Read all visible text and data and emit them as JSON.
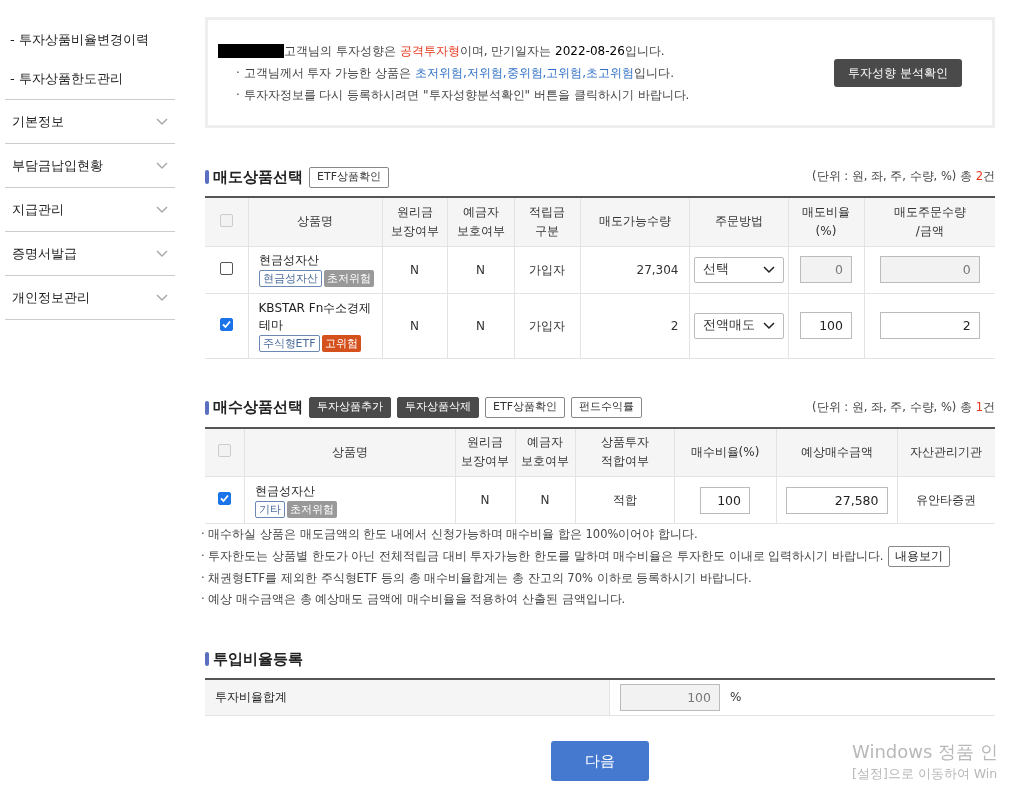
{
  "sidebar": {
    "sub_items": [
      "- 투자상품비율변경이력",
      "- 투자상품한도관리"
    ],
    "menu": [
      {
        "label": "기본정보",
        "expanded": false
      },
      {
        "label": "부담금납입현황",
        "expanded": false
      },
      {
        "label": "지급관리",
        "expanded": false
      },
      {
        "label": "증명서발급",
        "expanded": false
      },
      {
        "label": "개인정보관리",
        "expanded": false
      }
    ]
  },
  "profile": {
    "redacted": true,
    "lines": [
      [
        {
          "text": "고객님의 투자성향은 ",
          "kind": "plain"
        },
        {
          "text": "공격투자형",
          "kind": "warning"
        },
        {
          "text": "이며, 만기일자는 ",
          "kind": "plain"
        },
        {
          "text": "2022-08-26",
          "kind": "date"
        },
        {
          "text": "입니다.",
          "kind": "plain"
        }
      ],
      [
        {
          "text": "· 고객님께서 투자 가능한 상품은 ",
          "kind": "plain"
        },
        {
          "text": "초저위험,저위험,중위험,고위험,초고위험",
          "kind": "info"
        },
        {
          "text": "입니다.",
          "kind": "plain"
        }
      ],
      [
        {
          "text": "· 투자자정보를 다시 등록하시려면 \"투자성향분석확인\" 버튼을 클릭하시기 바랍니다.",
          "kind": "plain"
        }
      ]
    ],
    "button": "투자성향 분석확인"
  },
  "sell": {
    "title": "매도상품선택",
    "buttons": [
      {
        "label": "ETF상품확인",
        "kind": "outline"
      }
    ],
    "unit_note": "(단위 : 원, 좌, 주, 수량, %) 총",
    "count": "2",
    "count_suffix": "건",
    "columns": [
      "상품명",
      "원리금\n보장여부",
      "예금자\n보호여부",
      "적립금\n구분",
      "매도가능수량",
      "주문방법",
      "매도비율\n(%)",
      "매도주문수량\n/금액"
    ],
    "header_checkbox": {
      "checked": false,
      "disabled": true
    },
    "rows": [
      {
        "checked": false,
        "name": "현금성자산",
        "tags": [
          {
            "label": "현금성자산",
            "kind": "outline"
          },
          {
            "label": "초저위험",
            "kind": "filled",
            "color": "#999999"
          }
        ],
        "principal": "N",
        "depositor": "N",
        "type": "가입자",
        "available": "27,304",
        "method": "선택",
        "ratio": "0",
        "amount": "0",
        "disabled": true
      },
      {
        "checked": true,
        "name": "KBSTAR Fn수소경제테마",
        "tags": [
          {
            "label": "주식형ETF",
            "kind": "outline"
          },
          {
            "label": "고위험",
            "kind": "filled",
            "color": "#d4501c"
          }
        ],
        "principal": "N",
        "depositor": "N",
        "type": "가입자",
        "available": "2",
        "method": "전액매도",
        "ratio": "100",
        "amount": "2",
        "disabled": false
      }
    ]
  },
  "buy": {
    "title": "매수상품선택",
    "buttons": [
      {
        "label": "투자상품추가",
        "kind": "dark"
      },
      {
        "label": "투자상품삭제",
        "kind": "dark"
      },
      {
        "label": "ETF상품확인",
        "kind": "outline"
      },
      {
        "label": "펀드수익률",
        "kind": "outline"
      }
    ],
    "unit_note": "(단위 : 원, 좌, 주, 수량, %) 총",
    "count": "1",
    "count_suffix": "건",
    "columns": [
      "상품명",
      "원리금\n보장여부",
      "예금자\n보호여부",
      "상품투자\n적합여부",
      "매수비율(%)",
      "예상매수금액",
      "자산관리기관"
    ],
    "header_checkbox": {
      "checked": false,
      "disabled": true
    },
    "rows": [
      {
        "checked": true,
        "name": "현금성자산",
        "tags": [
          {
            "label": "기타",
            "kind": "outline"
          },
          {
            "label": "초저위험",
            "kind": "filled",
            "color": "#999999"
          }
        ],
        "principal": "N",
        "depositor": "N",
        "suitable": "적합",
        "ratio": "100",
        "amount": "27,580",
        "institution": "유안타증권"
      }
    ],
    "notes": [
      {
        "text": "· 매수하실 상품은 매도금액의 한도 내에서 신청가능하며 매수비율 합은 100%이어야 합니다."
      },
      {
        "text": "· 투자한도는 상품별 한도가 아닌 전체적립금 대비 투자가능한 한도를 말하며 매수비율은 투자한도 이내로 입력하시기 바랍니다.",
        "button": "내용보기"
      },
      {
        "text": "· 채권형ETF를 제외한 주식형ETF 등의 총 매수비율합계는 총 잔고의 70% 이하로 등록하시기 바랍니다."
      },
      {
        "text": "· 예상 매수금액은 총 예상매도 금액에 매수비율을 적용하여 산출된 금액입니다."
      }
    ]
  },
  "ratio": {
    "title": "투입비율등록",
    "label": "투자비율합계",
    "value": "100",
    "unit": "%"
  },
  "next_button": "다음",
  "os_notice": [
    "Windows 정품 인",
    "[설정]으로 이동하여 Win"
  ]
}
